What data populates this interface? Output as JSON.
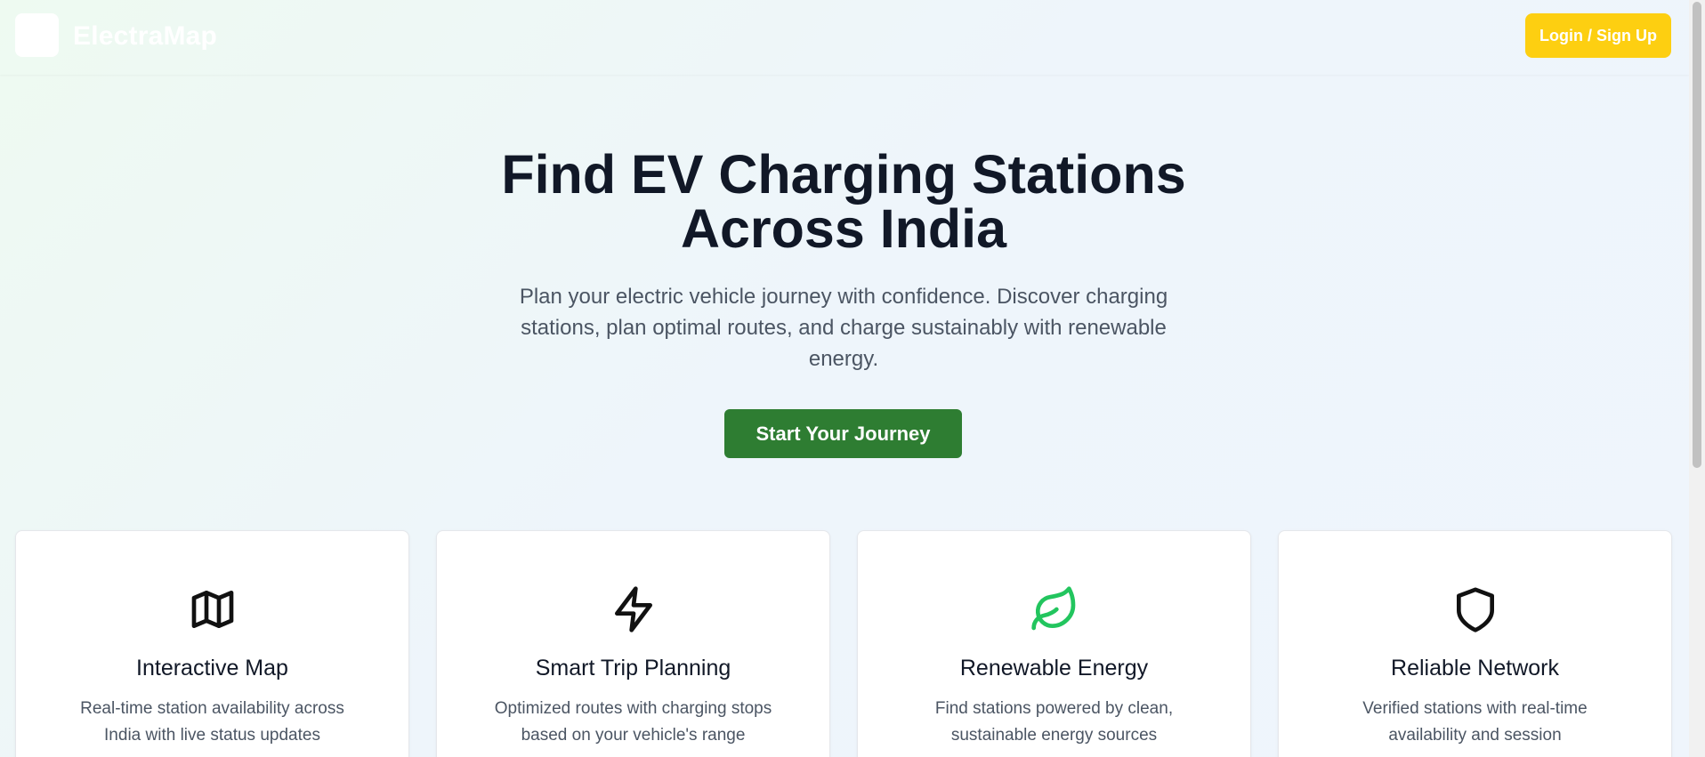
{
  "header": {
    "brand": "ElectraMap",
    "login_label": "Login / Sign Up",
    "login_color": "#fdcf11"
  },
  "hero": {
    "title_line1": "Find EV Charging Stations",
    "title_line2": "Across India",
    "subtitle": "Plan your electric vehicle journey with confidence. Discover charging stations, plan optimal routes, and charge sustainably with renewable energy.",
    "cta_label": "Start Your Journey",
    "cta_color": "#2e7d32"
  },
  "features": [
    {
      "icon": "map-icon",
      "title": "Interactive Map",
      "description": "Real-time station availability across India with live status updates"
    },
    {
      "icon": "lightning-icon",
      "title": "Smart Trip Planning",
      "description": "Optimized routes with charging stops based on your vehicle's range"
    },
    {
      "icon": "leaf-icon",
      "icon_color": "#22c55e",
      "title": "Renewable Energy",
      "description": "Find stations powered by clean, sustainable energy sources"
    },
    {
      "icon": "shield-icon",
      "title": "Reliable Network",
      "description": "Verified stations with real-time availability and session"
    }
  ]
}
